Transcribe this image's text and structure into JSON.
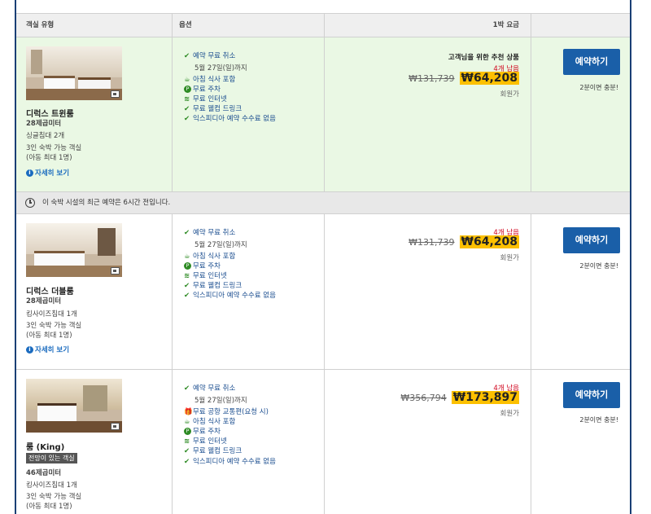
{
  "header": {
    "col_room_type": "객실 유형",
    "col_options": "옵션",
    "col_price": "1박 요금"
  },
  "rooms": [
    {
      "name": "디럭스 트윈룸",
      "size": "28제곱미터",
      "beds": "싱글침대 2개",
      "occupancy": "3인 숙박 가능 객실",
      "children": "(아동 최대 1명)",
      "details_link": "자세히 보기",
      "options": {
        "free_cancel": "예약 무료 취소",
        "cancel_until": "5월 27일(일)까지",
        "breakfast": "아침 식사 포함",
        "parking": "무료 주차",
        "internet": "무료 인터넷",
        "welcome_drink": "무료 웰컴 드링크",
        "no_fee": "익스피디아 예약 수수료 없음"
      },
      "recommended": "고객님을 위한 추천 상품",
      "rooms_left": "4개 남음",
      "old_price": "₩131,739",
      "new_price": "₩64,208",
      "member_rate": "회원가",
      "book_label": "예약하기",
      "quick_note": "2분이면 충분!"
    },
    {
      "name": "디럭스 더블룸",
      "size": "28제곱미터",
      "beds": "킹사이즈침대 1개",
      "occupancy": "3인 숙박 가능 객실",
      "children": "(아동 최대 1명)",
      "details_link": "자세히 보기",
      "options": {
        "free_cancel": "예약 무료 취소",
        "cancel_until": "5월 27일(일)까지",
        "breakfast": "아침 식사 포함",
        "parking": "무료 주차",
        "internet": "무료 인터넷",
        "welcome_drink": "무료 웰컴 드링크",
        "no_fee": "익스피디아 예약 수수료 없음"
      },
      "rooms_left": "4개 남음",
      "old_price": "₩131,739",
      "new_price": "₩64,208",
      "member_rate": "회원가",
      "book_label": "예약하기",
      "quick_note": "2분이면 충분!"
    },
    {
      "name": "룸 (King)",
      "view_badge": "전망이 있는 객실",
      "size": "46제곱미터",
      "beds": "킹사이즈침대 1개",
      "occupancy": "3인 숙박 가능 객실",
      "children": "(아동 최대 1명)",
      "options": {
        "free_cancel": "예약 무료 취소",
        "cancel_until": "5월 27일(일)까지",
        "airport_shuttle": "무료 공항 교통편(요청 시)",
        "breakfast": "아침 식사 포함",
        "parking": "무료 주차",
        "internet": "무료 인터넷",
        "welcome_drink": "무료 웰컴 드링크",
        "no_fee": "익스피디아 예약 수수료 없음"
      },
      "rooms_left": "4개 남음",
      "old_price": "₩356,794",
      "new_price": "₩173,897",
      "member_rate": "회원가",
      "book_label": "예약하기",
      "quick_note": "2분이면 충분!"
    }
  ],
  "notice": "이 숙박 시설의 최근 예약은 6시간 전입니다.",
  "colors": {
    "frame": "#1a3f75",
    "highlight_row": "#eaf8e4",
    "book_button": "#1a5fa8",
    "price_highlight": "#fcc000",
    "rooms_left": "#d0021b",
    "check": "#2e8b24",
    "link": "#1a6bbf"
  }
}
